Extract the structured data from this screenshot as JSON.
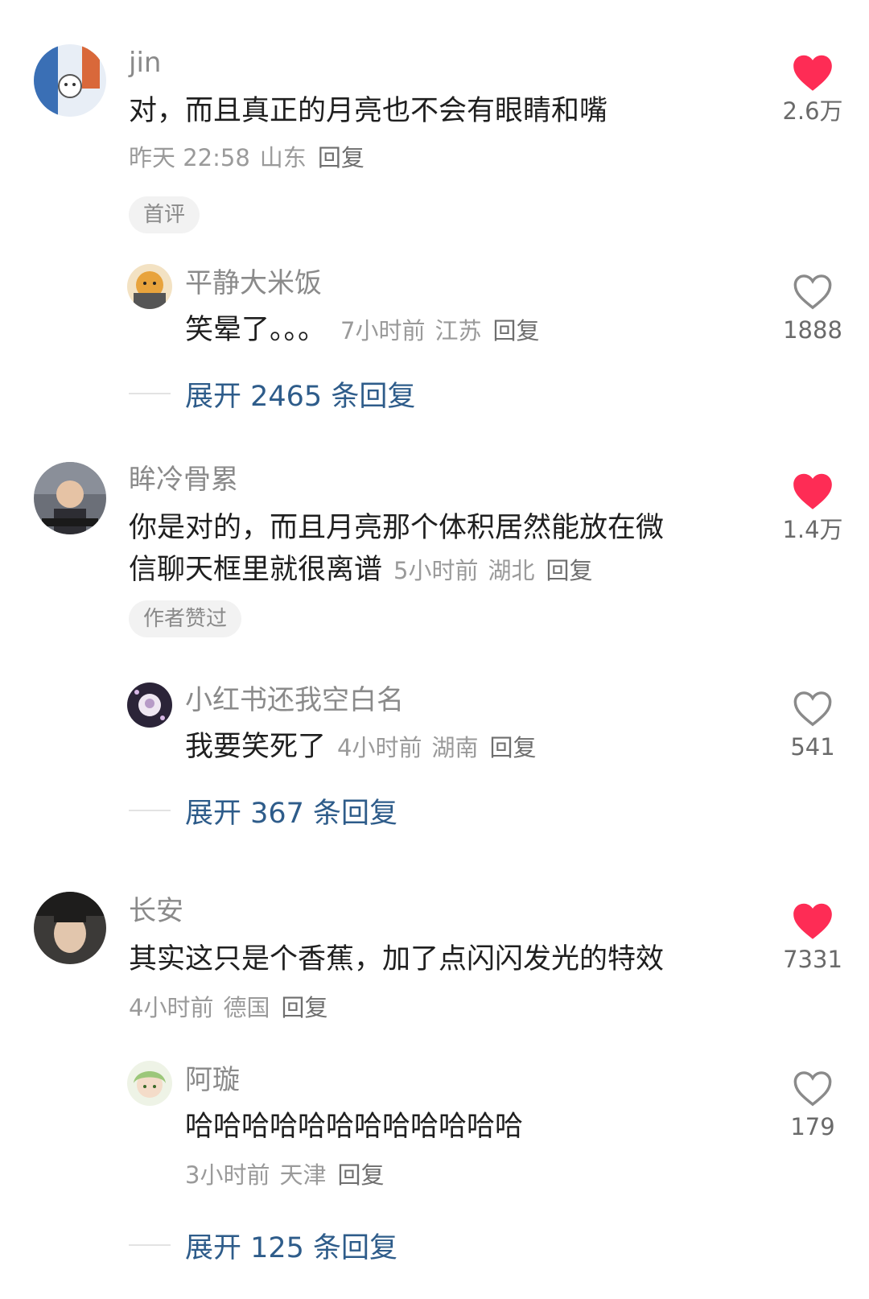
{
  "threads": [
    {
      "comment": {
        "username": "jin",
        "text_lines": [
          "对，而且真正的月亮也不会有眼睛和嘴"
        ],
        "time": "昨天 22:58",
        "location": "山东",
        "reply_label": "回复",
        "badge": "首评",
        "likes": "2.6万",
        "liked": true
      },
      "reply": {
        "username": "平静大米饭",
        "text": "笑晕了。。。",
        "time": "7小时前",
        "location": "江苏",
        "reply_label": "回复",
        "likes": "1888",
        "liked": false
      },
      "expand_label": "展开 2465 条回复"
    },
    {
      "comment": {
        "username": "眸冷骨累",
        "text_lines": [
          "你是对的，而且月亮那个体积居然能放在微",
          "信聊天框里就很离谱"
        ],
        "time": "5小时前",
        "location": "湖北",
        "reply_label": "回复",
        "badge": "作者赞过",
        "likes": "1.4万",
        "liked": true
      },
      "reply": {
        "username": "小红书还我空白名",
        "text": "我要笑死了",
        "time": "4小时前",
        "location": "湖南",
        "reply_label": "回复",
        "likes": "541",
        "liked": false
      },
      "expand_label": "展开 367 条回复"
    },
    {
      "comment": {
        "username": "长安",
        "text_lines": [
          "其实这只是个香蕉，加了点闪闪发光的特效"
        ],
        "time": "4小时前",
        "location": "德国",
        "reply_label": "回复",
        "likes": "7331",
        "liked": true
      },
      "reply": {
        "username": "阿璇",
        "text": "哈哈哈哈哈哈哈哈哈哈哈哈",
        "time": "3小时前",
        "location": "天津",
        "reply_label": "回复",
        "likes": "179",
        "liked": false
      },
      "expand_label": "展开 125 条回复"
    }
  ],
  "colors": {
    "heart_active": "#fe2c55",
    "heart_outline": "#8a8a8a",
    "expand_link": "#2e5c8a"
  }
}
